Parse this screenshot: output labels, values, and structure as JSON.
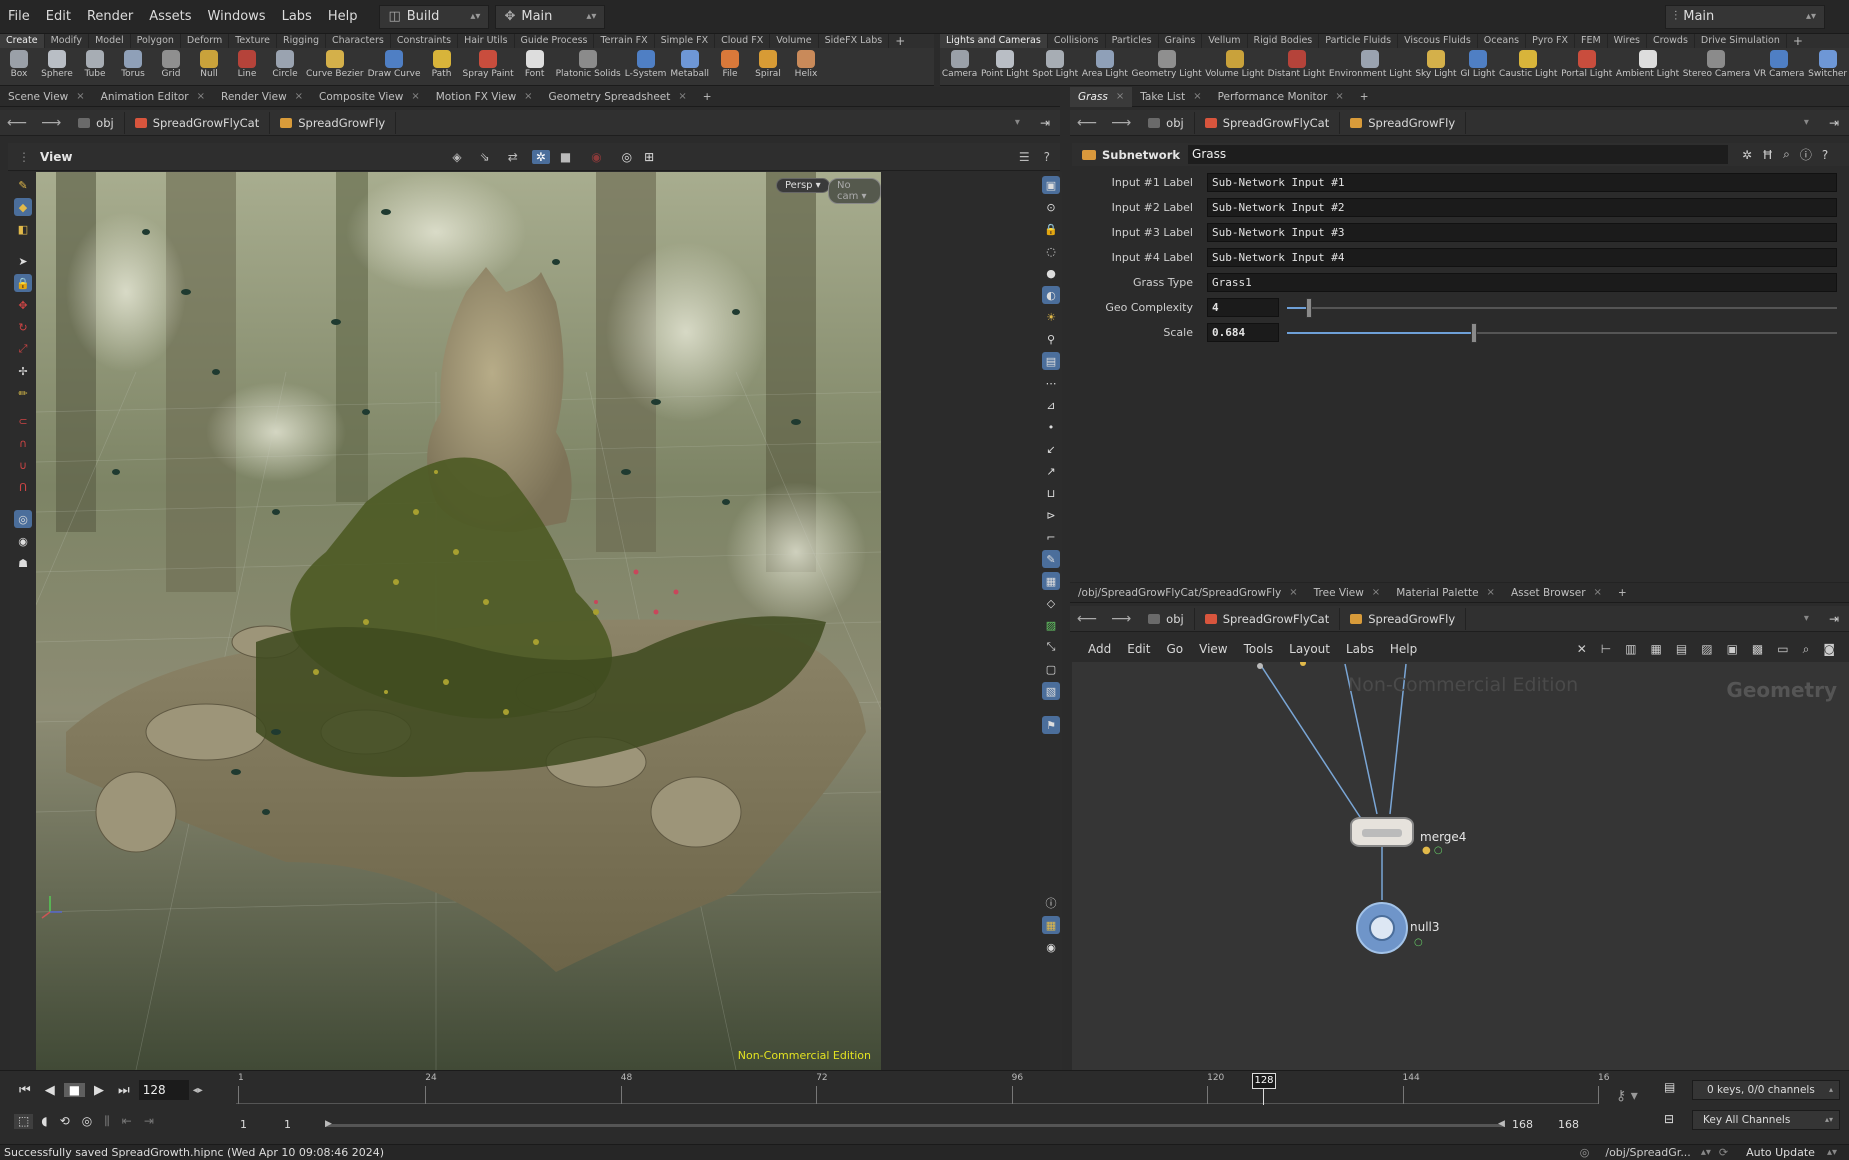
{
  "menubar": {
    "items": [
      "File",
      "Edit",
      "Render",
      "Assets",
      "Windows",
      "Labs",
      "Help"
    ],
    "desktop": "Build",
    "context": "Main",
    "desktop_right": "Main"
  },
  "shelf_left": {
    "tabs": [
      "Create",
      "Modify",
      "Model",
      "Polygon",
      "Deform",
      "Texture",
      "Rigging",
      "Characters",
      "Constraints",
      "Hair Utils",
      "Guide Process",
      "Terrain FX",
      "Simple FX",
      "Cloud FX",
      "Volume",
      "SideFX Labs"
    ],
    "tools": [
      {
        "label": "Box",
        "icon": "box-icon"
      },
      {
        "label": "Sphere",
        "icon": "sphere-icon"
      },
      {
        "label": "Tube",
        "icon": "tube-icon"
      },
      {
        "label": "Torus",
        "icon": "torus-icon"
      },
      {
        "label": "Grid",
        "icon": "grid-icon"
      },
      {
        "label": "Null",
        "icon": "null-icon"
      },
      {
        "label": "Line",
        "icon": "line-icon"
      },
      {
        "label": "Circle",
        "icon": "circle-icon"
      },
      {
        "label": "Curve Bezier",
        "icon": "curve-bezier-icon"
      },
      {
        "label": "Draw Curve",
        "icon": "draw-curve-icon"
      },
      {
        "label": "Path",
        "icon": "path-icon"
      },
      {
        "label": "Spray Paint",
        "icon": "spray-paint-icon"
      },
      {
        "label": "Font",
        "icon": "font-icon"
      },
      {
        "label": "Platonic Solids",
        "icon": "platonic-icon"
      },
      {
        "label": "L-System",
        "icon": "lsystem-icon"
      },
      {
        "label": "Metaball",
        "icon": "metaball-icon"
      },
      {
        "label": "File",
        "icon": "file-icon"
      },
      {
        "label": "Spiral",
        "icon": "spiral-icon"
      },
      {
        "label": "Helix",
        "icon": "helix-icon"
      }
    ]
  },
  "shelf_right": {
    "tabs": [
      "Lights and Cameras",
      "Collisions",
      "Particles",
      "Grains",
      "Vellum",
      "Rigid Bodies",
      "Particle Fluids",
      "Viscous Fluids",
      "Oceans",
      "Pyro FX",
      "FEM",
      "Wires",
      "Crowds",
      "Drive Simulation"
    ],
    "tools": [
      {
        "label": "Camera",
        "icon": "camera-icon"
      },
      {
        "label": "Point Light",
        "icon": "point-light-icon"
      },
      {
        "label": "Spot Light",
        "icon": "spot-light-icon"
      },
      {
        "label": "Area Light",
        "icon": "area-light-icon"
      },
      {
        "label": "Geometry Light",
        "icon": "geometry-light-icon"
      },
      {
        "label": "Volume Light",
        "icon": "volume-light-icon"
      },
      {
        "label": "Distant Light",
        "icon": "distant-light-icon"
      },
      {
        "label": "Environment Light",
        "icon": "environment-light-icon"
      },
      {
        "label": "Sky Light",
        "icon": "sky-light-icon"
      },
      {
        "label": "GI Light",
        "icon": "gi-light-icon"
      },
      {
        "label": "Caustic Light",
        "icon": "caustic-light-icon"
      },
      {
        "label": "Portal Light",
        "icon": "portal-light-icon"
      },
      {
        "label": "Ambient Light",
        "icon": "ambient-light-icon"
      },
      {
        "label": "Stereo Camera",
        "icon": "stereo-camera-icon"
      },
      {
        "label": "VR Camera",
        "icon": "vr-camera-icon"
      },
      {
        "label": "Switcher",
        "icon": "switcher-icon"
      }
    ]
  },
  "left_pane": {
    "tabs": [
      "Scene View",
      "Animation Editor",
      "Render View",
      "Composite View",
      "Motion FX View",
      "Geometry Spreadsheet"
    ],
    "path": [
      "obj",
      "SpreadGrowFlyCat",
      "SpreadGrowFly"
    ],
    "view_label": "View",
    "persp": "Persp",
    "cam": "No cam",
    "watermark": "Non-Commercial Edition"
  },
  "param_pane": {
    "tabs": [
      "Grass",
      "Take List",
      "Performance Monitor"
    ],
    "path": [
      "obj",
      "SpreadGrowFlyCat",
      "SpreadGrowFly"
    ],
    "node_type": "Subnetwork",
    "node_name": "Grass",
    "params": [
      {
        "label": "Input #1 Label",
        "value": "Sub-Network Input #1"
      },
      {
        "label": "Input #2 Label",
        "value": "Sub-Network Input #2"
      },
      {
        "label": "Input #3 Label",
        "value": "Sub-Network Input #3"
      },
      {
        "label": "Input #4 Label",
        "value": "Sub-Network Input #4"
      },
      {
        "label": "Grass Type",
        "value": "Grass1"
      }
    ],
    "geo_complexity": {
      "label": "Geo Complexity",
      "value": "4",
      "fraction": 0.04
    },
    "scale": {
      "label": "Scale",
      "value": "0.684",
      "fraction": 0.34
    }
  },
  "network_pane": {
    "tabs": [
      "/obj/SpreadGrowFlyCat/SpreadGrowFly",
      "Tree View",
      "Material Palette",
      "Asset Browser"
    ],
    "path": [
      "obj",
      "SpreadGrowFlyCat",
      "SpreadGrowFly"
    ],
    "menu": [
      "Add",
      "Edit",
      "Go",
      "View",
      "Tools",
      "Layout",
      "Labs",
      "Help"
    ],
    "watermark": "Non-Commercial Edition",
    "context_label": "Geometry",
    "nodes": [
      {
        "name": "merge4"
      },
      {
        "name": "null3"
      }
    ]
  },
  "timeline": {
    "current_frame": "128",
    "ticks": [
      "1",
      "24",
      "48",
      "72",
      "96",
      "120",
      "144",
      "16"
    ],
    "marker": "128",
    "start": "1",
    "start2": "1",
    "end": "168",
    "end2": "168",
    "keys": "0 keys, 0/0 channels",
    "key_all": "Key All Channels"
  },
  "statusbar": {
    "message": "Successfully saved SpreadGrowth.hipnc (Wed Apr 10 09:08:46 2024)",
    "path": "/obj/SpreadGr...",
    "update": "Auto Update"
  },
  "colors": {
    "accent": "#4f7fc4",
    "viewport_bg": "#5c6a55",
    "node_bg": "#353535"
  }
}
